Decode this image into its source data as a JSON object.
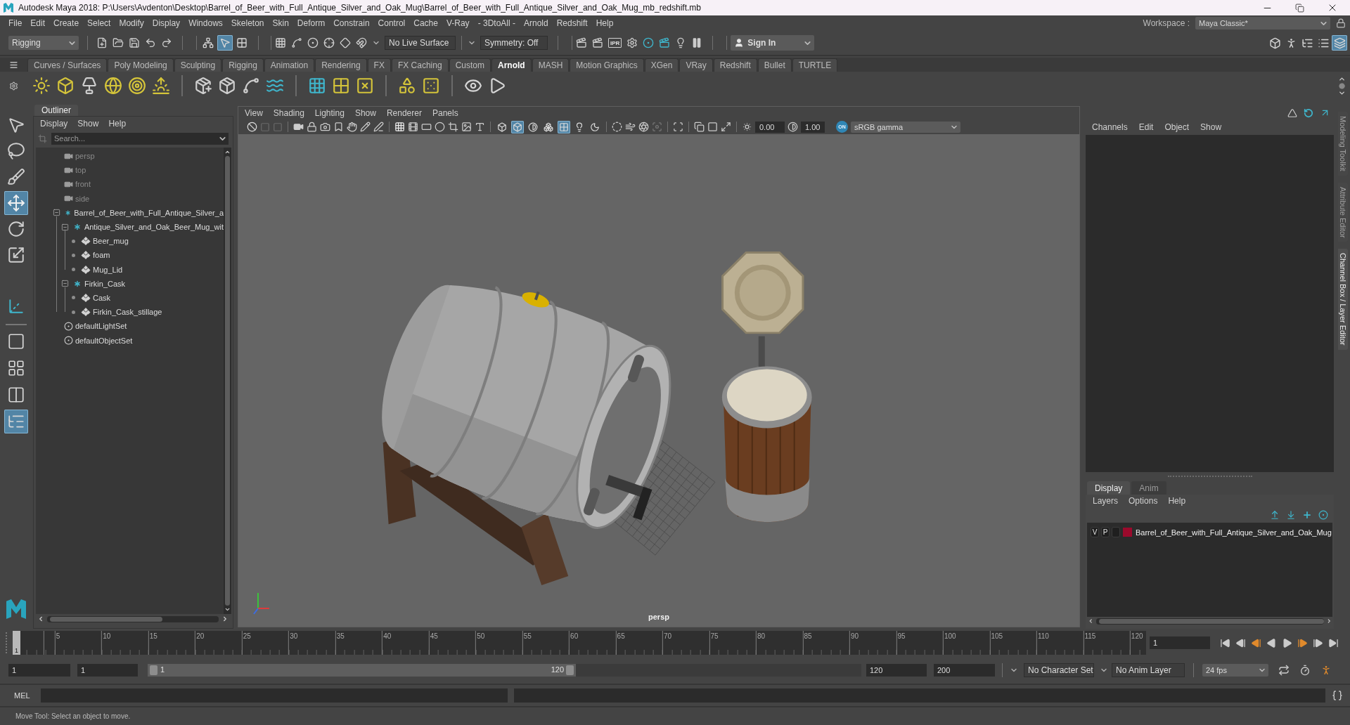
{
  "window": {
    "title": "Autodesk Maya 2018: P:\\Users\\Avdenton\\Desktop\\Barrel_of_Beer_with_Full_Antique_Silver_and_Oak_Mug\\Barrel_of_Beer_with_Full_Antique_Silver_and_Oak_Mug_mb_redshift.mb"
  },
  "menu_bar": {
    "items": [
      "File",
      "Edit",
      "Create",
      "Select",
      "Modify",
      "Display",
      "Windows",
      "Skeleton",
      "Skin",
      "Deform",
      "Constrain",
      "Control",
      "Cache",
      "V-Ray",
      "- 3DtoAll -",
      "Arnold",
      "Redshift",
      "Help"
    ],
    "workspace_label": "Workspace :",
    "workspace": "Maya Classic*"
  },
  "status_line": {
    "menu_set": "Rigging",
    "selection_modes": [
      {
        "kind": "hierarchy",
        "selected": false
      },
      {
        "kind": "object",
        "selected": true
      },
      {
        "kind": "component",
        "selected": false
      }
    ],
    "live_surface": "No Live Surface",
    "symmetry": "Symmetry: Off",
    "ipr": "IPR",
    "sign_in": "Sign In",
    "panel_toggles": [
      {
        "kind": "modeling",
        "selected": false
      },
      {
        "kind": "character",
        "selected": false
      },
      {
        "kind": "attributes",
        "selected": false
      },
      {
        "kind": "tool_settings",
        "selected": false
      },
      {
        "kind": "channel_box",
        "selected": true
      }
    ]
  },
  "shelf": {
    "tabs": [
      {
        "label": "Curves / Surfaces",
        "selected": false
      },
      {
        "label": "Poly Modeling",
        "selected": false
      },
      {
        "label": "Sculpting",
        "selected": false
      },
      {
        "label": "Rigging",
        "selected": false
      },
      {
        "label": "Animation",
        "selected": false
      },
      {
        "label": "Rendering",
        "selected": false
      },
      {
        "label": "FX",
        "selected": false
      },
      {
        "label": "FX Caching",
        "selected": false
      },
      {
        "label": "Custom",
        "selected": false
      },
      {
        "label": "Arnold",
        "selected": true
      },
      {
        "label": "MASH",
        "selected": false
      },
      {
        "label": "Motion Graphics",
        "selected": false
      },
      {
        "label": "XGen",
        "selected": false
      },
      {
        "label": "VRay",
        "selected": false
      },
      {
        "label": "Redshift",
        "selected": false
      },
      {
        "label": "Bullet",
        "selected": false
      },
      {
        "label": "TURTLE",
        "selected": false
      }
    ]
  },
  "toolbox": {
    "tools": [
      {
        "kind": "select",
        "selected": false
      },
      {
        "kind": "lasso",
        "selected": false
      },
      {
        "kind": "paint",
        "selected": false
      },
      {
        "kind": "move",
        "selected": true
      },
      {
        "kind": "rotate",
        "selected": false
      },
      {
        "kind": "scale",
        "selected": false
      },
      {
        "kind": "manipulator",
        "selected": false
      }
    ],
    "layouts": [
      {
        "kind": "single",
        "selected": false
      },
      {
        "kind": "four",
        "selected": false
      },
      {
        "kind": "two",
        "selected": false
      },
      {
        "kind": "outliner",
        "selected": true
      }
    ]
  },
  "outliner": {
    "title": "Outliner",
    "menus": [
      "Display",
      "Show",
      "Help"
    ],
    "search": {
      "placeholder": "Search..."
    },
    "items": [
      {
        "kind": "camera",
        "label": "persp",
        "dimmed": true
      },
      {
        "kind": "camera",
        "label": "top",
        "dimmed": true
      },
      {
        "kind": "camera",
        "label": "front",
        "dimmed": true
      },
      {
        "kind": "camera",
        "label": "side",
        "dimmed": true
      },
      {
        "kind": "group",
        "label": "Barrel_of_Beer_with_Full_Antique_Silver_a",
        "dimmed": false,
        "expanded": true,
        "children": [
          {
            "kind": "group",
            "label": "Antique_Silver_and_Oak_Beer_Mug_wit",
            "dimmed": false,
            "expanded": true,
            "children": [
              {
                "kind": "mesh",
                "label": "Beer_mug",
                "dimmed": false
              },
              {
                "kind": "mesh",
                "label": "foam",
                "dimmed": false
              },
              {
                "kind": "mesh",
                "label": "Mug_Lid",
                "dimmed": false
              }
            ]
          },
          {
            "kind": "group",
            "label": "Firkin_Cask",
            "dimmed": false,
            "expanded": true,
            "children": [
              {
                "kind": "mesh",
                "label": "Cask",
                "dimmed": false
              },
              {
                "kind": "mesh",
                "label": "Firkin_Cask_stillage",
                "dimmed": false
              }
            ]
          }
        ]
      },
      {
        "kind": "set",
        "label": "defaultLightSet",
        "dimmed": false
      },
      {
        "kind": "set",
        "label": "defaultObjectSet",
        "dimmed": false
      }
    ]
  },
  "viewport": {
    "menus": [
      "View",
      "Shading",
      "Lighting",
      "Show",
      "Renderer",
      "Panels"
    ],
    "shading_toggles": [
      {
        "kind": "wireframe",
        "on": false
      },
      {
        "kind": "smooth",
        "on": true
      },
      {
        "kind": "default_material",
        "on": false
      },
      {
        "kind": "wireframe_on_shaded",
        "on": false
      },
      {
        "kind": "textured",
        "on": true
      },
      {
        "kind": "lights",
        "on": false
      },
      {
        "kind": "shadows",
        "on": false
      }
    ],
    "exposure": "0.00",
    "gamma": "1.00",
    "color_management": "ON",
    "view_transform": "sRGB gamma",
    "camera_label": "persp"
  },
  "channel_box": {
    "menus": [
      "Channels",
      "Edit",
      "Object",
      "Show"
    ]
  },
  "layer_editor": {
    "tabs": [
      {
        "label": "Display",
        "selected": true
      },
      {
        "label": "Anim",
        "selected": false
      }
    ],
    "menus": [
      "Layers",
      "Options",
      "Help"
    ],
    "layers": [
      {
        "visible": "V",
        "playback": "P",
        "color": "#9b0a2c",
        "name": "Barrel_of_Beer_with_Full_Antique_Silver_and_Oak_Mug"
      }
    ]
  },
  "side_tabs": [
    {
      "label": "Modeling Toolkit",
      "selected": false
    },
    {
      "label": "Attribute Editor",
      "selected": false
    },
    {
      "label": "Channel Box / Layer Editor",
      "selected": true
    }
  ],
  "time_slider": {
    "ticks": [
      "5",
      "10",
      "15",
      "20",
      "25",
      "30",
      "35",
      "40",
      "45",
      "50",
      "55",
      "60",
      "65",
      "70",
      "75",
      "80",
      "85",
      "90",
      "95",
      "100",
      "105",
      "110",
      "115",
      "120"
    ],
    "current_frame": "1",
    "level": 0,
    "current_time": "1"
  },
  "range_slider": {
    "start_time": "1",
    "playback_start": "1",
    "range_start": "1",
    "range_end": "120",
    "level": 0.6,
    "playback_end": "120",
    "end_time": "200",
    "character_set": "No Character Set",
    "anim_layer": "No Anim Layer",
    "fps": "24 fps"
  },
  "command_line": {
    "language": "MEL"
  },
  "help_line": {
    "text": "Move Tool: Select an object to move."
  }
}
